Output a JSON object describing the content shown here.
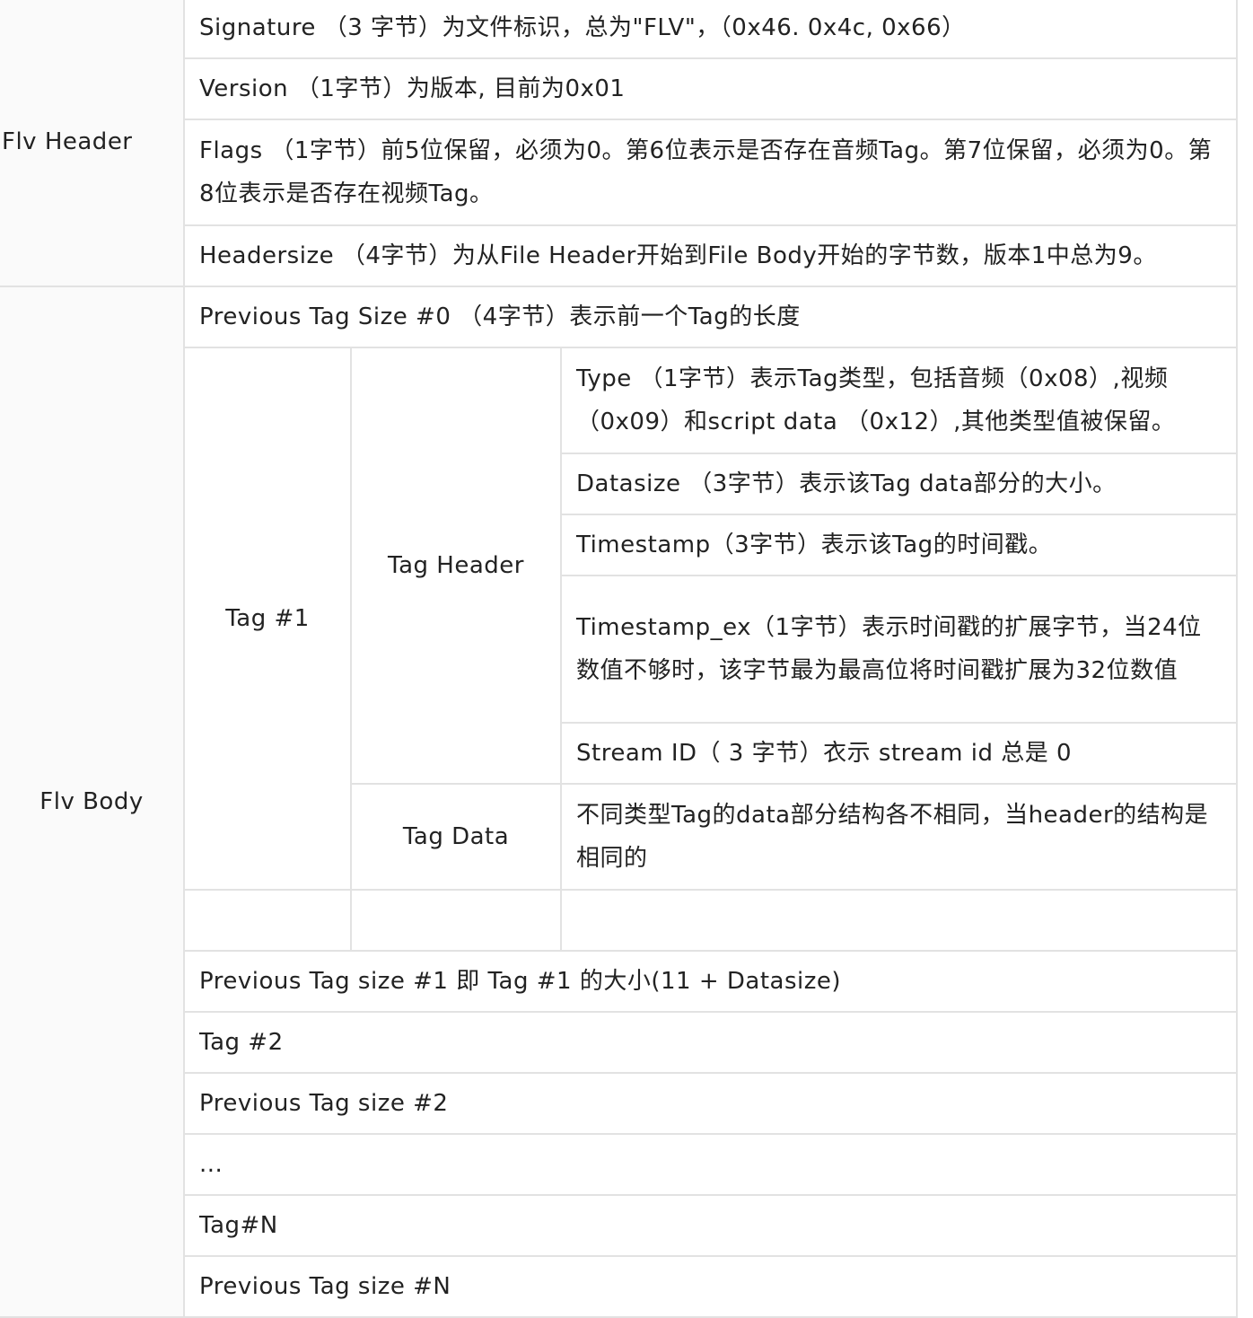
{
  "table": {
    "flv_header": {
      "label": "Flv Header",
      "signature": "Signature （3 字节）为文件标识，总为\"FLV\"，（0x46. 0x4c, 0x66）",
      "version": "Version （1字节）为版本, 目前为0x01",
      "flags": "Flags （1字节）前5位保留，必须为0。第6位表示是否存在音频Tag。第7位保留，必须为0。第8位表示是否存在视频Tag。",
      "headersize": "Headersize （4字节）为从File Header开始到File Body开始的字节数，版本1中总为9。"
    },
    "flv_body": {
      "label": "Flv Body",
      "previous_tag_size_0": "Previous Tag Size #0 （4字节）表示前一个Tag的长度",
      "tag1": {
        "label": "Tag #1",
        "tag_header": {
          "label": "Tag Header",
          "type": "Type （1字节）表示Tag类型，包括音频（0x08）,视频（0x09）和script data （0x12）,其他类型值被保留。",
          "datasize": "Datasize （3字节）表示该Tag data部分的大小。",
          "timestamp": "Timestamp（3字节）表示该Tag的时间戳。",
          "timestamp_ex": "Timestamp_ex（1字节）表示时间戳的扩展字节，当24位数值不够时，该字节最为最高位将时间戳扩展为32位数值",
          "stream_id": "Stream ID（ 3 字节）衣示 stream id 总是 0"
        },
        "tag_data": {
          "label": "Tag Data",
          "description": "不同类型Tag的data部分结构各不相同，当header的结构是相同的"
        }
      },
      "rows": [
        "Previous Tag size #1 即 Tag #1 的大小(11 + Datasize)",
        "Tag #2",
        "Previous Tag size #2",
        "...",
        "Tag#N",
        "Previous Tag size #N"
      ]
    }
  }
}
